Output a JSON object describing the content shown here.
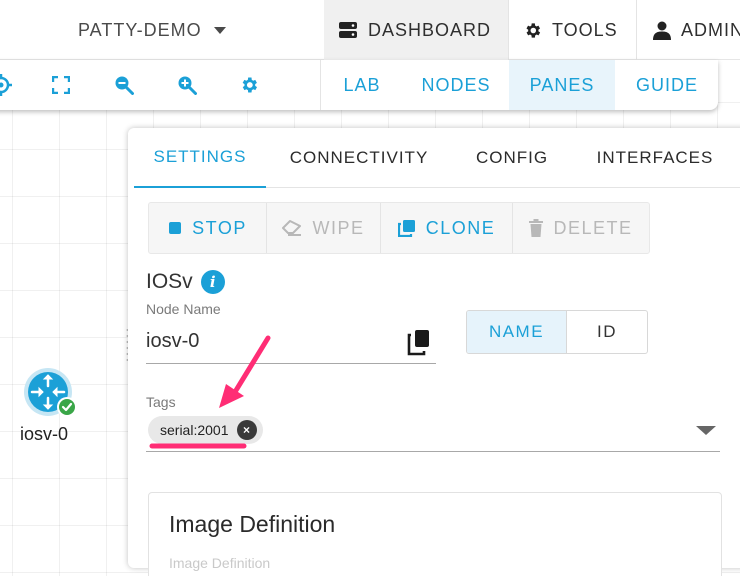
{
  "header": {
    "lab_name": "PATTY-DEMO",
    "nav": {
      "dashboard": "DASHBOARD",
      "tools": "TOOLS",
      "admin": "ADMIN"
    }
  },
  "toolbar": {
    "icons": [
      "target-icon",
      "fit-screen-icon",
      "zoom-out-icon",
      "zoom-in-icon",
      "settings-gear-icon"
    ],
    "view_tabs": [
      {
        "label": "LAB",
        "active": false
      },
      {
        "label": "NODES",
        "active": false
      },
      {
        "label": "PANES",
        "active": true
      },
      {
        "label": "GUIDE",
        "active": false
      }
    ]
  },
  "canvas": {
    "node": {
      "label": "iosv-0",
      "icon": "router-icon",
      "status": "running"
    }
  },
  "pane": {
    "tabs": [
      {
        "label": "SETTINGS",
        "active": true
      },
      {
        "label": "CONNECTIVITY",
        "active": false
      },
      {
        "label": "CONFIG",
        "active": false
      },
      {
        "label": "INTERFACES",
        "active": false
      }
    ],
    "actions": [
      {
        "label": "STOP",
        "icon": "stop-icon",
        "enabled": true
      },
      {
        "label": "WIPE",
        "icon": "eraser-icon",
        "enabled": false
      },
      {
        "label": "CLONE",
        "icon": "clone-icon",
        "enabled": true
      },
      {
        "label": "DELETE",
        "icon": "trash-icon",
        "enabled": false
      }
    ],
    "node_definition": "IOSv",
    "node_name_label": "Node Name",
    "node_name_value": "iosv-0",
    "toggle": {
      "name": "NAME",
      "id": "ID"
    },
    "tags_label": "Tags",
    "tags": [
      "serial:2001"
    ],
    "image_card": {
      "title": "Image Definition",
      "subtitle": "Image Definition"
    }
  },
  "colors": {
    "accent": "#1ba0d7",
    "annotation": "#ff2d75",
    "status_ok": "#3aa648"
  }
}
